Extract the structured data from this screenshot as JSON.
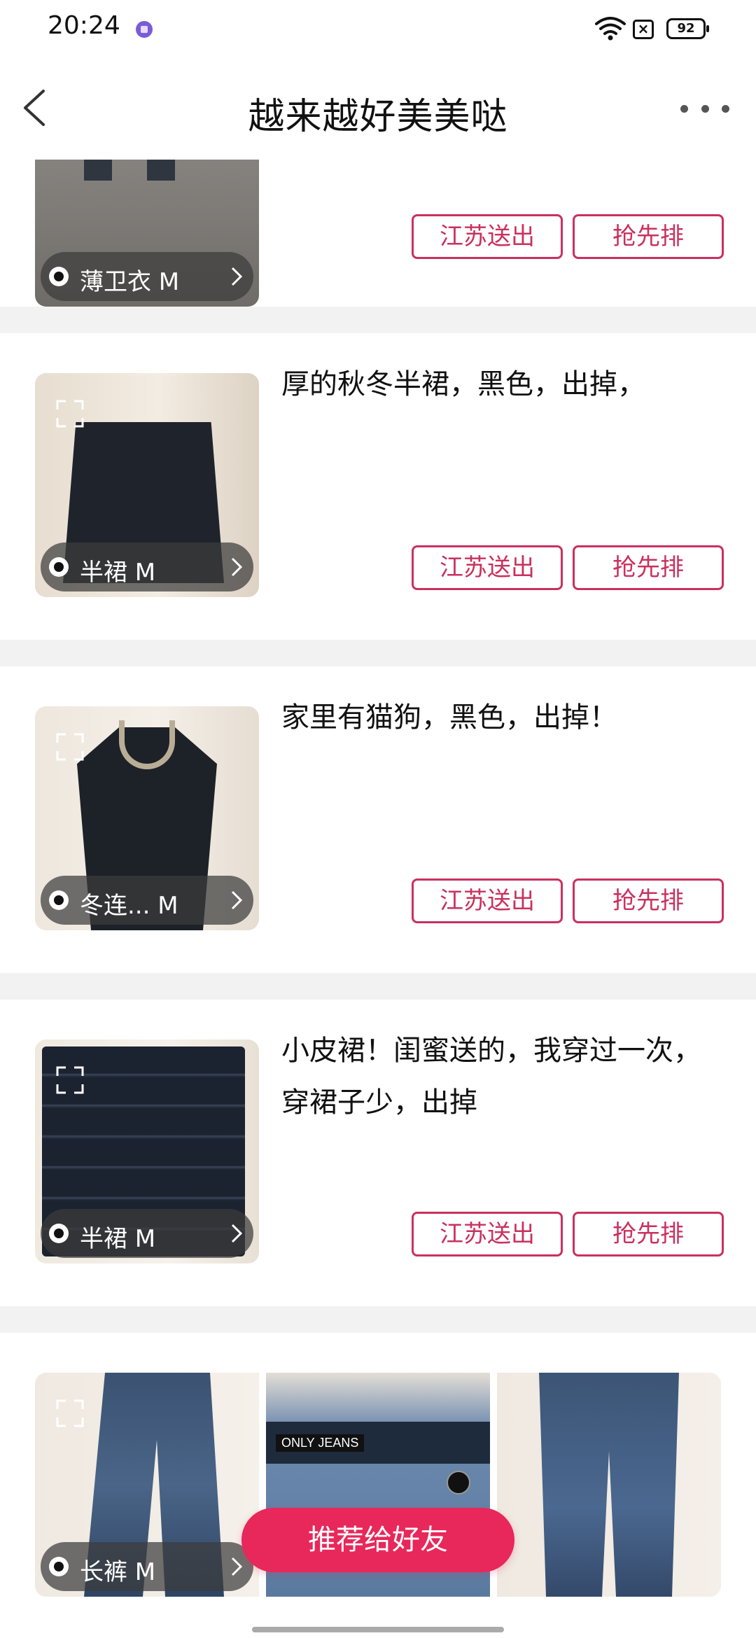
{
  "status_bar": {
    "time": "20:24",
    "sim_label": "×",
    "battery": "92"
  },
  "header": {
    "title": "越来越好美美哒"
  },
  "items": [
    {
      "tag_label": "薄卫衣 M",
      "description": "",
      "shipping_label": "江苏送出",
      "claim_label": "抢先排"
    },
    {
      "tag_label": "半裙 M",
      "description": "厚的秋冬半裙，黑色，出掉，",
      "shipping_label": "江苏送出",
      "claim_label": "抢先排"
    },
    {
      "tag_label": "冬连... M",
      "description": "家里有猫狗，黑色，出掉！",
      "shipping_label": "江苏送出",
      "claim_label": "抢先排"
    },
    {
      "tag_label": "半裙 M",
      "description": "小皮裙！闺蜜送的，我穿过一次，穿裙子少，出掉",
      "shipping_label": "江苏送出",
      "claim_label": "抢先排"
    },
    {
      "tag_label": "长裤 M",
      "description": "",
      "shipping_label": "",
      "claim_label": ""
    }
  ],
  "photo_brand_text": "ONLY JEANS",
  "recommend_button": "推荐给好友",
  "colors": {
    "accent": "#c9315e",
    "cta": "#e8275a",
    "divider": "#f2f2f2"
  },
  "icons": [
    "wifi-icon",
    "sim-icon",
    "battery-icon",
    "back-icon",
    "more-icon",
    "expand-icon",
    "chevron-right-icon"
  ]
}
